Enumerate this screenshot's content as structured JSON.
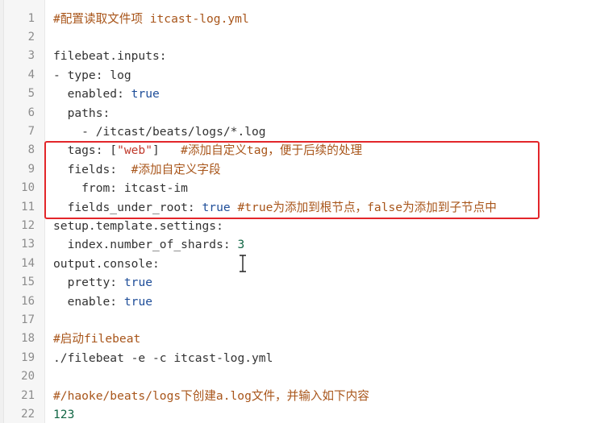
{
  "editor": {
    "lines": [
      {
        "n": "1",
        "tokens": [
          {
            "t": "#配置读取文件项 itcast-log.yml",
            "c": "comment"
          }
        ]
      },
      {
        "n": "2",
        "tokens": []
      },
      {
        "n": "3",
        "tokens": [
          {
            "t": "filebeat.inputs:",
            "c": "key"
          }
        ]
      },
      {
        "n": "4",
        "tokens": [
          {
            "t": "- type: ",
            "c": "key"
          },
          {
            "t": "log",
            "c": "plain"
          }
        ]
      },
      {
        "n": "5",
        "tokens": [
          {
            "t": "  enabled: ",
            "c": "key"
          },
          {
            "t": "true",
            "c": "kw"
          }
        ]
      },
      {
        "n": "6",
        "tokens": [
          {
            "t": "  paths:",
            "c": "key"
          }
        ]
      },
      {
        "n": "7",
        "tokens": [
          {
            "t": "    - /itcast/beats/logs/*.log",
            "c": "plain"
          }
        ]
      },
      {
        "n": "8",
        "tokens": [
          {
            "t": "  tags: [",
            "c": "key"
          },
          {
            "t": "\"web\"",
            "c": "str"
          },
          {
            "t": "]   ",
            "c": "plain"
          },
          {
            "t": "#添加自定义tag，便于后续的处理",
            "c": "comment"
          }
        ]
      },
      {
        "n": "9",
        "tokens": [
          {
            "t": "  fields:  ",
            "c": "key"
          },
          {
            "t": "#添加自定义字段",
            "c": "comment"
          }
        ]
      },
      {
        "n": "10",
        "tokens": [
          {
            "t": "    from: ",
            "c": "key"
          },
          {
            "t": "itcast-im",
            "c": "plain"
          }
        ]
      },
      {
        "n": "11",
        "tokens": [
          {
            "t": "  fields_under_root: ",
            "c": "key"
          },
          {
            "t": "true",
            "c": "kw"
          },
          {
            "t": " ",
            "c": "plain"
          },
          {
            "t": "#true为添加到根节点，false为添加到子节点中",
            "c": "comment"
          }
        ]
      },
      {
        "n": "12",
        "tokens": [
          {
            "t": "setup.template.settings:",
            "c": "key"
          }
        ]
      },
      {
        "n": "13",
        "tokens": [
          {
            "t": "  index.number_of_shards: ",
            "c": "key"
          },
          {
            "t": "3",
            "c": "num"
          }
        ]
      },
      {
        "n": "14",
        "tokens": [
          {
            "t": "output.console:",
            "c": "key"
          }
        ]
      },
      {
        "n": "15",
        "tokens": [
          {
            "t": "  pretty: ",
            "c": "key"
          },
          {
            "t": "true",
            "c": "kw"
          }
        ]
      },
      {
        "n": "16",
        "tokens": [
          {
            "t": "  enable: ",
            "c": "key"
          },
          {
            "t": "true",
            "c": "kw"
          }
        ]
      },
      {
        "n": "17",
        "tokens": []
      },
      {
        "n": "18",
        "tokens": [
          {
            "t": "#启动filebeat",
            "c": "comment"
          }
        ]
      },
      {
        "n": "19",
        "tokens": [
          {
            "t": "./filebeat -e -c itcast-log.yml",
            "c": "plain"
          }
        ]
      },
      {
        "n": "20",
        "tokens": []
      },
      {
        "n": "21",
        "tokens": [
          {
            "t": "#/haoke/beats/logs下创建a.log文件，并输入如下内容",
            "c": "comment"
          }
        ]
      },
      {
        "n": "22",
        "tokens": [
          {
            "t": "123",
            "c": "num"
          }
        ]
      }
    ],
    "highlight_color": "#e3262a",
    "cursor_icon": "text-cursor-icon"
  }
}
